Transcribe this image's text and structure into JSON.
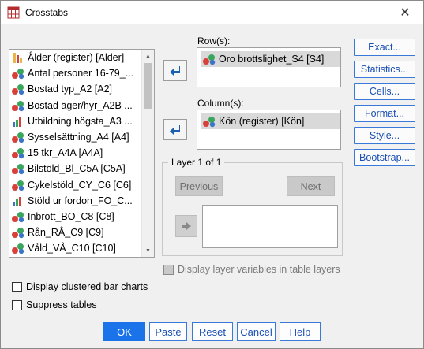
{
  "window": {
    "title": "Crosstabs",
    "close_symbol": "✕"
  },
  "variables": [
    {
      "label": "Ålder (register) [Alder]",
      "type": "scale"
    },
    {
      "label": "Antal personer 16-79_...",
      "type": "nominal"
    },
    {
      "label": "Bostad typ_A2 [A2]",
      "type": "nominal"
    },
    {
      "label": "Bostad äger/hyr_A2B ...",
      "type": "nominal"
    },
    {
      "label": "Utbildning högsta_A3 ...",
      "type": "ordinal"
    },
    {
      "label": "Sysselsättning_A4 [A4]",
      "type": "nominal"
    },
    {
      "label": "15 tkr_A4A [A4A]",
      "type": "nominal"
    },
    {
      "label": "Bilstöld_Bl_C5A [C5A]",
      "type": "nominal"
    },
    {
      "label": "Cykelstöld_CY_C6 [C6]",
      "type": "nominal"
    },
    {
      "label": "Stöld ur fordon_FO_C...",
      "type": "ordinal"
    },
    {
      "label": "Inbrott_BO_C8 [C8]",
      "type": "nominal"
    },
    {
      "label": "Rån_RÅ_C9 [C9]",
      "type": "nominal"
    },
    {
      "label": "Våld_VÅ_C10 [C10]",
      "type": "nominal"
    }
  ],
  "rows": {
    "label": "Row(s):",
    "items": [
      "Oro brottslighet_S4 [S4]"
    ]
  },
  "columns": {
    "label": "Column(s):",
    "items": [
      "Kön (register) [Kön]"
    ]
  },
  "layer": {
    "title": "Layer 1 of 1",
    "previous": "Previous",
    "next": "Next"
  },
  "side_buttons": [
    "Exact...",
    "Statistics...",
    "Cells...",
    "Format...",
    "Style...",
    "Bootstrap..."
  ],
  "checkboxes": {
    "display_layer_vars": "Display layer variables in table layers",
    "clustered_bar": "Display clustered bar charts",
    "suppress_tables": "Suppress tables"
  },
  "bottom_buttons": {
    "ok": "OK",
    "paste": "Paste",
    "reset": "Reset",
    "cancel": "Cancel",
    "help": "Help"
  },
  "colors": {
    "accent": "#1a73e8",
    "link_text": "#1a4fb5",
    "arrow_blue": "#1a5fb4"
  }
}
